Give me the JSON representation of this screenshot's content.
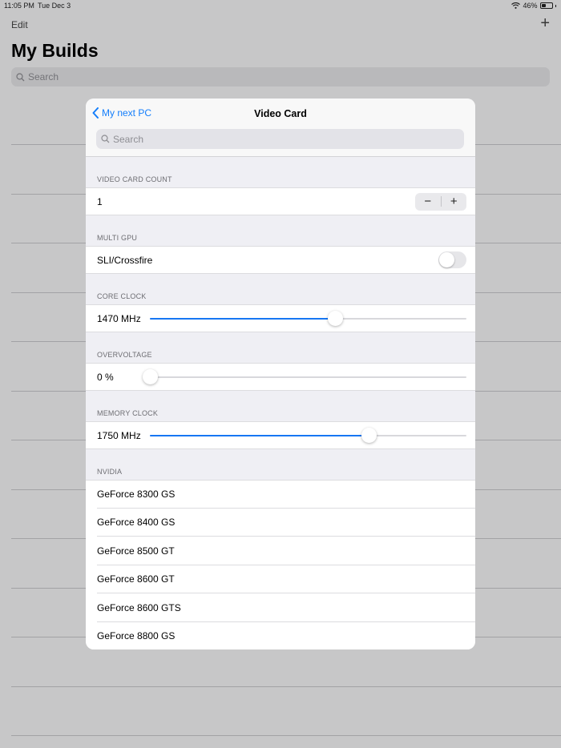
{
  "status_bar": {
    "time": "11:05 PM",
    "date": "Tue Dec 3",
    "battery": "46%",
    "battery_level": 0.46
  },
  "background": {
    "edit_label": "Edit",
    "title": "My Builds",
    "search_placeholder": "Search",
    "add_icon": "plus-icon"
  },
  "modal": {
    "back_label": "My next PC",
    "title": "Video Card",
    "search_placeholder": "Search",
    "sections": {
      "count": {
        "header": "VIDEO CARD COUNT",
        "value": "1",
        "minus": "−",
        "plus": "+"
      },
      "multi_gpu": {
        "header": "MULTI GPU",
        "label": "SLI/Crossfire",
        "enabled": false
      },
      "core_clock": {
        "header": "CORE CLOCK",
        "value": "1470 MHz",
        "fraction": 0.585
      },
      "overvoltage": {
        "header": "OVERVOLTAGE",
        "value": "0 %",
        "fraction": 0.0
      },
      "memory_clock": {
        "header": "MEMORY CLOCK",
        "value": "1750 MHz",
        "fraction": 0.69
      }
    },
    "nvidia": {
      "header": "NVIDIA",
      "items": [
        "GeForce 8300 GS",
        "GeForce 8400 GS",
        "GeForce 8500 GT",
        "GeForce 8600 GT",
        "GeForce 8600 GTS",
        "GeForce 8800 GS"
      ]
    }
  },
  "colors": {
    "accent": "#147efb",
    "slider_fill": "#1776f3"
  }
}
